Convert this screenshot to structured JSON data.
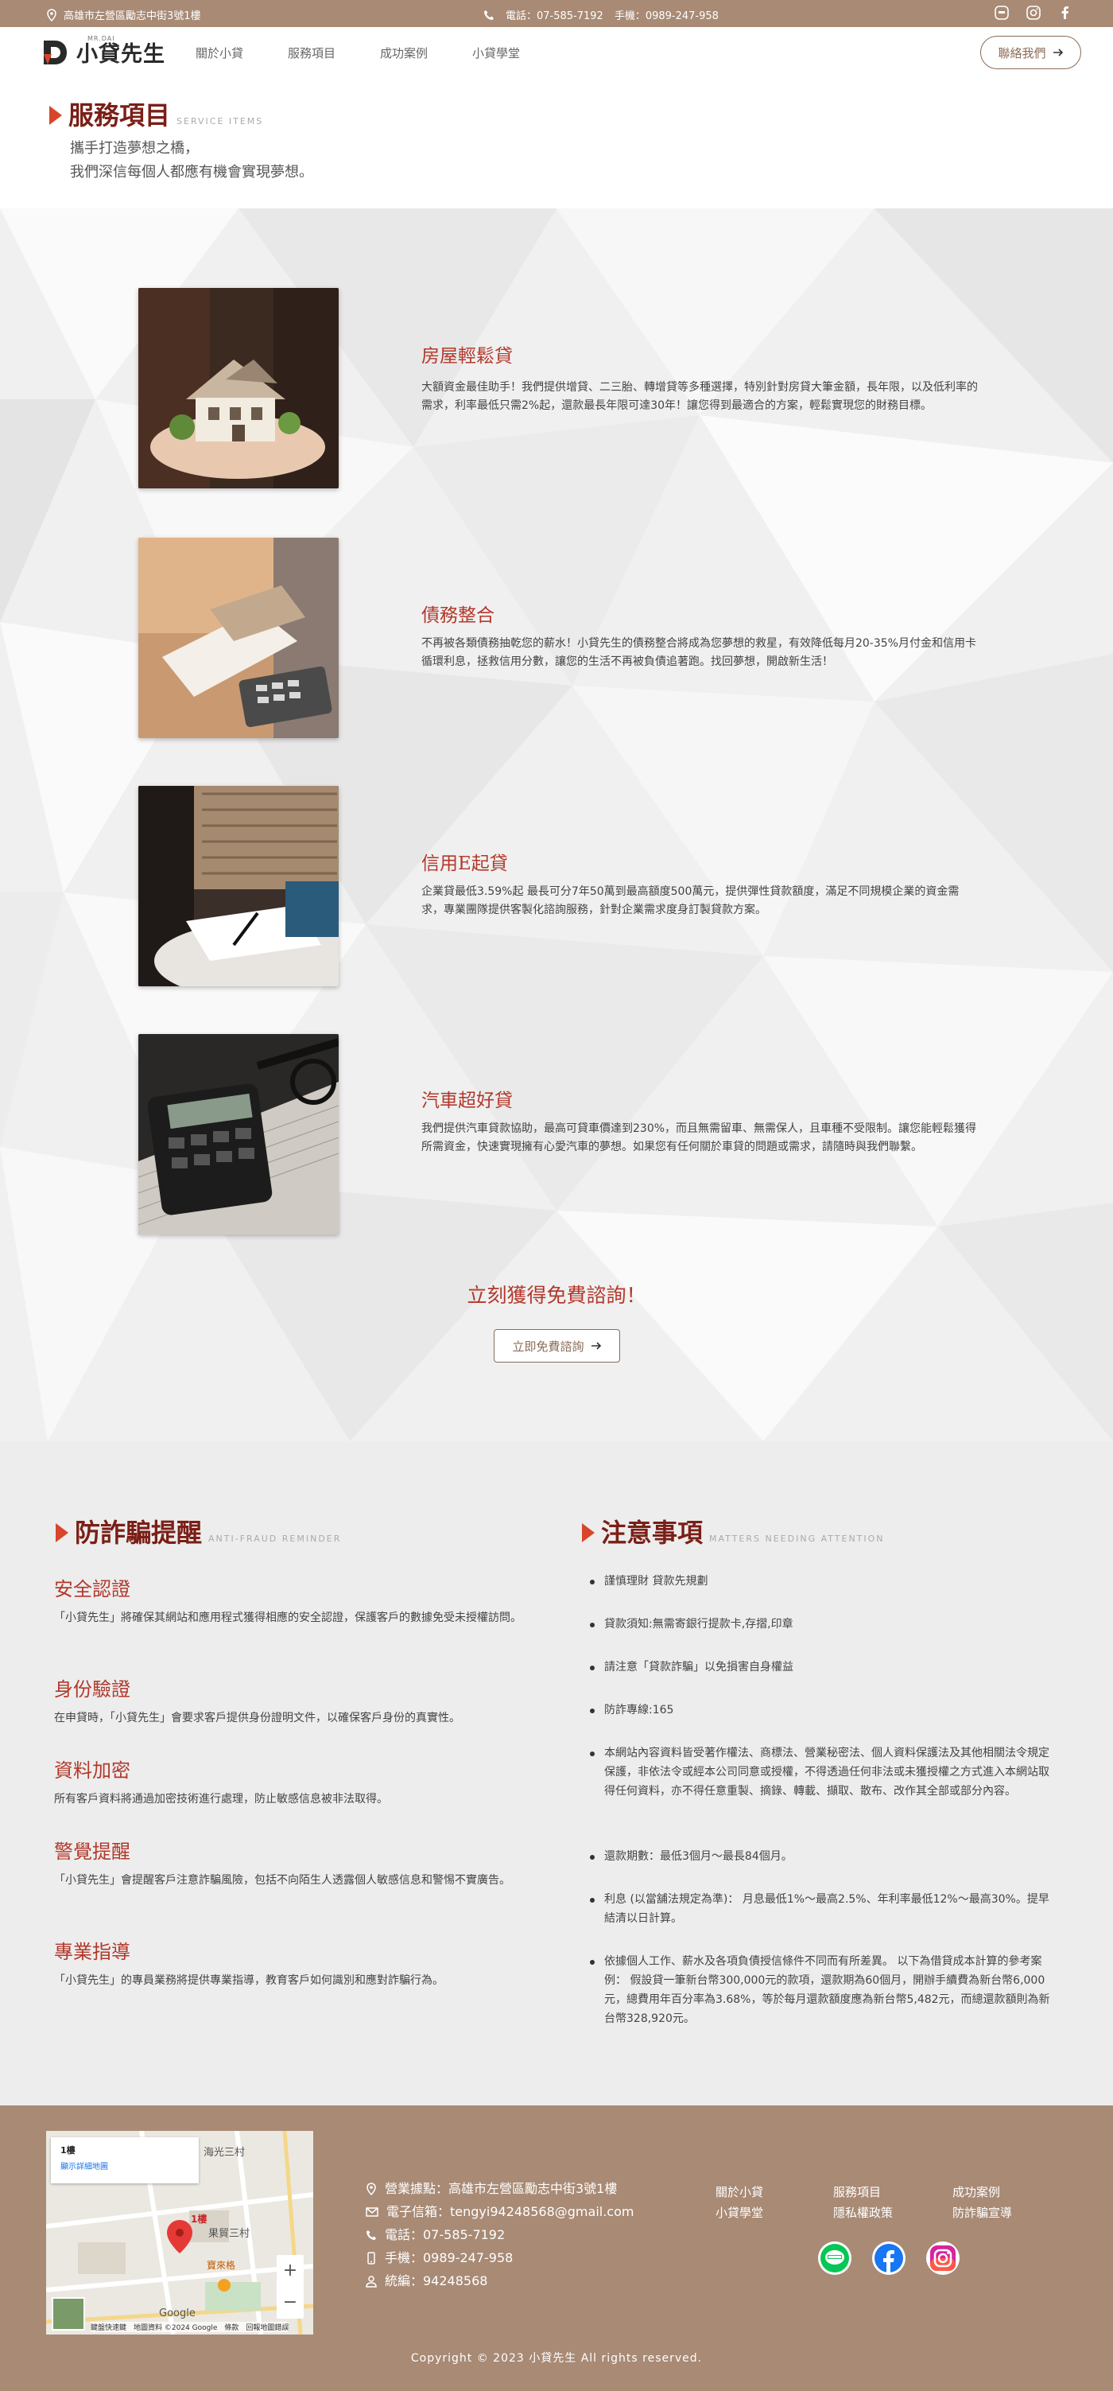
{
  "topbar": {
    "address": "高雄市左營區勵志中街3號1樓",
    "phone": "電話：07-585-7192",
    "mobile": "手機：0989-247-958"
  },
  "nav": {
    "logo_main": "小貸先生",
    "logo_en": "MR.DAI",
    "items": [
      "關於小貸",
      "服務項目",
      "成功案例",
      "小貸學堂"
    ],
    "contact_btn": "聯絡我們"
  },
  "header": {
    "title": "服務項目",
    "subtitle": "SERVICE ITEMS",
    "lead_1": "攜手打造夢想之橋，",
    "lead_2": "我們深信每個人都應有機會實現夢想。"
  },
  "services": [
    {
      "title": "房屋輕鬆貸",
      "desc": "大額資金最佳助手！我們提供增貸、二三胎、轉增貸等多種選擇，特別針對房貸大筆金額，長年限，以及低利率的需求，利率最低只需2%起，還款最長年限可達30年！讓您得到最適合的方案，輕鬆實現您的財務目標。"
    },
    {
      "title": "債務整合",
      "desc": "不再被各類債務抽乾您的薪水！小貸先生的債務整合將成為您夢想的救星，有效降低每月20-35%月付金和信用卡循環利息，拯救信用分數，讓您的生活不再被負債追著跑。找回夢想，開啟新生活！"
    },
    {
      "title": "信用E起貸",
      "desc": "企業貸最低3.59%起 最長可分7年50萬到最高額度500萬元，提供彈性貸款額度，滿足不同規模企業的資金需求，專業團隊提供客製化諮詢服務，針對企業需求度身訂製貸款方案。"
    },
    {
      "title": "汽車超好貸",
      "desc": "我們提供汽車貸款協助，最高可貸車價達到230%，而且無需留車、無需保人，且車種不受限制。讓您能輕鬆獲得所需資金，快速實現擁有心愛汽車的夢想。如果您有任何關於車貸的問題或需求，請隨時與我們聯繫。"
    }
  ],
  "cta": {
    "title": "立刻獲得免費諮詢！",
    "button": "立即免費諮詢"
  },
  "fraud": {
    "title": "防詐騙提醒",
    "subtitle": "ANTI-FRAUD REMINDER",
    "items": [
      {
        "title": "安全認證",
        "desc": "「小貸先生」將確保其網站和應用程式獲得相應的安全認證，保護客戶的數據免受未授權訪問。"
      },
      {
        "title": "身份驗證",
        "desc": "在申貸時，「小貸先生」會要求客戶提供身份證明文件，以確保客戶身份的真實性。"
      },
      {
        "title": "資料加密",
        "desc": "所有客戶資料將通過加密技術進行處理，防止敏感信息被非法取得。"
      },
      {
        "title": "警覺提醒",
        "desc": "「小貸先生」會提醒客戶注意詐騙風險，包括不向陌生人透露個人敏感信息和警惕不實廣告。"
      },
      {
        "title": "專業指導",
        "desc": "「小貸先生」的專員業務將提供專業指導，教育客戶如何識別和應對詐騙行為。"
      }
    ]
  },
  "notes": {
    "title": "注意事項",
    "subtitle": "MATTERS NEEDING ATTENTION",
    "items": [
      "謹慎理財 貸款先規劃",
      "貸款須知:無需寄銀行提款卡,存摺,印章",
      "請注意「貸款詐騙」以免損害自身權益",
      "防詐專線:165",
      "本網站內容資料皆受著作權法、商標法、營業秘密法、個人資料保護法及其他相關法令規定保護，非依法令或經本公司同意或授權，不得透過任何非法或未獲授權之方式進入本網站取得任何資料，亦不得任意重製、摘錄、轉載、擷取、散布、改作其全部或部分內容。",
      "還款期數：最低3個月～最長84個月。",
      "利息 (以當舖法規定為準)： 月息最低1%～最高2.5%、年利率最低12%～最高30%。提早結清以日計算。",
      "依據個人工作、薪水及各項負債授信條件不同而有所差異。 以下為借貸成本計算的參考案例： 假設貸一筆新台幣300,000元的款項，還款期為60個月，開辦手續費為新台幣6,000元，總費用年百分率為3.68%，等於每月還款額度應為新台幣5,482元，而總還款額則為新台幣328,920元。"
    ]
  },
  "footer": {
    "map_place": "1樓",
    "map_link": "顯示詳細地圖",
    "map_label_1": "海光三村",
    "map_label_2": "果貿三村",
    "map_label_3": "寶來格",
    "map_label_4": "1樓",
    "map_footer": "鍵盤快速鍵　地圖資料 ©2024 Google　條款　回報地圖錯誤",
    "map_google": "Google",
    "office": "營業據點：高雄市左營區勵志中街3號1樓",
    "email": "電子信箱：tengyi94248568@gmail.com",
    "phone": "電話：07-585-7192",
    "mobile": "手機：0989-247-958",
    "taxid": "統編：94248568",
    "links": [
      "關於小貸",
      "服務項目",
      "成功案例",
      "小貸學堂",
      "隱私權政策",
      "防詐騙宣導"
    ],
    "copyright": "Copyright © 2023 小貸先生 All rights reserved."
  }
}
